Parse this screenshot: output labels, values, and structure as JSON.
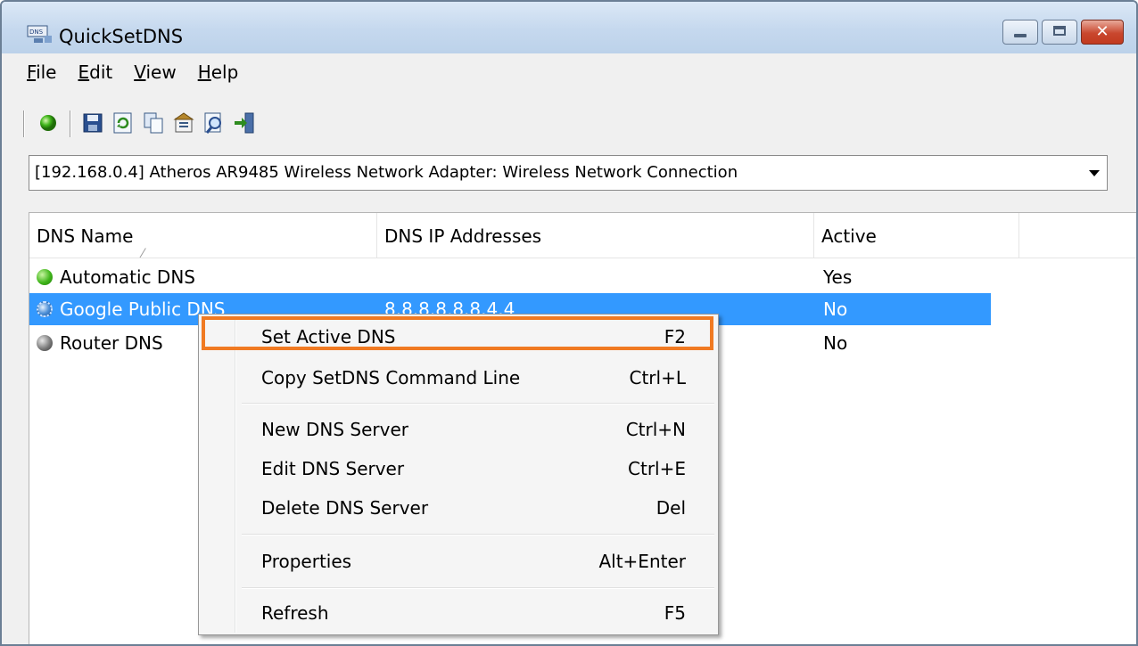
{
  "window": {
    "title": "QuickSetDNS",
    "icon": "dns-app-icon"
  },
  "menu": [
    {
      "label": "File",
      "mnemonic": "F",
      "rest": "ile"
    },
    {
      "label": "Edit",
      "mnemonic": "E",
      "rest": "dit"
    },
    {
      "label": "View",
      "mnemonic": "V",
      "rest": "iew"
    },
    {
      "label": "Help",
      "mnemonic": "H",
      "rest": "elp"
    }
  ],
  "toolbar": {
    "icons": [
      "green-dot-icon",
      "save-icon",
      "refresh-icon",
      "copy-icon",
      "properties-icon",
      "find-icon",
      "exit-icon"
    ]
  },
  "adapter": {
    "selected": "[192.168.0.4]  Atheros AR9485 Wireless Network Adapter: Wireless Network Connection"
  },
  "list": {
    "columns": [
      "DNS Name",
      "DNS IP Addresses",
      "Active"
    ],
    "rows": [
      {
        "name": "Automatic DNS",
        "ips": "",
        "active": "Yes",
        "status": "green"
      },
      {
        "name": "Google Public DNS",
        "ips": "8.8.8.8,8.8.4.4",
        "active": "No",
        "status": "blue"
      },
      {
        "name": "Router DNS",
        "ips": "",
        "active": "No",
        "status": "gray"
      }
    ]
  },
  "context_menu": {
    "items": [
      {
        "label": "Set Active DNS",
        "shortcut": "F2"
      },
      {
        "label": "Copy SetDNS Command Line",
        "shortcut": "Ctrl+L"
      },
      {
        "label": "New DNS Server",
        "shortcut": "Ctrl+N"
      },
      {
        "label": "Edit DNS Server",
        "shortcut": "Ctrl+E"
      },
      {
        "label": "Delete DNS Server",
        "shortcut": "Del"
      },
      {
        "label": "Properties",
        "shortcut": "Alt+Enter"
      },
      {
        "label": "Refresh",
        "shortcut": "F5"
      }
    ]
  },
  "colors": {
    "selection": "#3399ff",
    "highlight": "#f07a22"
  }
}
